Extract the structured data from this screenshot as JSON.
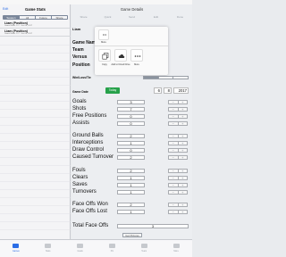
{
  "left": {
    "edit_label": "Edit",
    "title": "Game Stats",
    "segments": [
      "Season",
      "All",
      "Future",
      "Share"
    ],
    "games": [
      {
        "name": "Liam (Position)",
        "sub": "Game Notes ### · Jun 08, 2017"
      },
      {
        "name": "Liam (Position)",
        "sub": "Game Notes ### · Jun 08, 2017"
      }
    ]
  },
  "right": {
    "title": "Game Details",
    "topnav": [
      "Share",
      "Quick",
      "Send",
      "Edit",
      "Done"
    ],
    "fields": {
      "player": "Liam",
      "game_name": "Game Name",
      "team": "Team",
      "versus": "Versus",
      "position": "Position",
      "win_loss_tie": "Win/Loss/Tie"
    },
    "date": {
      "label": "Game Date",
      "today_label": "Today",
      "month": "6",
      "day": "8",
      "year": "2017"
    },
    "stats": [
      {
        "label": "Goals",
        "value": "3",
        "bold": false
      },
      {
        "label": "Shots",
        "value": "7",
        "bold": false
      },
      {
        "label": "Free Positions",
        "value": "0",
        "bold": false
      },
      {
        "label": "Assists",
        "value": "0",
        "bold": false
      },
      {
        "label": "Ground Balls",
        "value": "2",
        "bold": false
      },
      {
        "label": "Interceptions",
        "value": "1",
        "bold": false
      },
      {
        "label": "Draw Control",
        "value": "0",
        "bold": false
      },
      {
        "label": "Caused Turnover",
        "value": "2",
        "bold": false
      },
      {
        "label": "Fouls",
        "value": "2",
        "bold": false
      },
      {
        "label": "Clears",
        "value": "1",
        "bold": false
      },
      {
        "label": "Saves",
        "value": "1",
        "bold": false
      },
      {
        "label": "Turnovers",
        "value": "1",
        "bold": false
      },
      {
        "label": "Face Offs Won",
        "value": "2",
        "bold": false
      },
      {
        "label": "Face Offs Lost",
        "value": "1",
        "bold": false
      }
    ],
    "total": {
      "label": "Total Face Offs",
      "value": "3"
    },
    "get_pictures": "Get Pictures",
    "stepper_minus": "−",
    "stepper_plus": "+"
  },
  "share_sheet": {
    "more_label": "More",
    "actions": [
      {
        "label": "Copy",
        "icon": "copy-icon"
      },
      {
        "label": "Add to Cloud Drive",
        "icon": "cloud-icon"
      },
      {
        "label": "More",
        "icon": "more-icon"
      }
    ]
  },
  "tabbar": [
    {
      "label": "Games",
      "icon": "list-icon",
      "active": true
    },
    {
      "label": "Stats",
      "icon": "chart-icon",
      "active": false
    },
    {
      "label": "Goals",
      "icon": "target-icon",
      "active": false
    },
    {
      "label": "Pic",
      "icon": "photo-icon",
      "active": false
    },
    {
      "label": "Team",
      "icon": "people-icon",
      "active": false
    },
    {
      "label": "More",
      "icon": "more-icon",
      "active": false
    }
  ]
}
